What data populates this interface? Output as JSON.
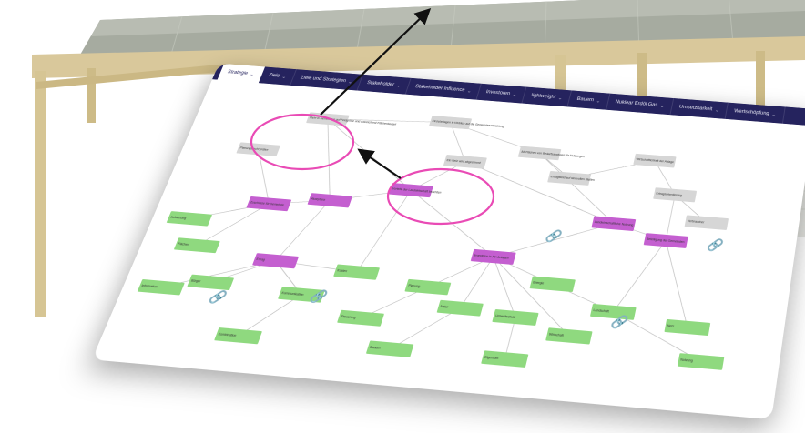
{
  "tabs": [
    {
      "label": "Strategie",
      "active": true
    },
    {
      "label": "Ziele"
    },
    {
      "label": "Ziele und Strategien"
    },
    {
      "label": "Stakeholder"
    },
    {
      "label": "Stakeholder Influence"
    },
    {
      "label": "Investoren"
    },
    {
      "label": "lightweight"
    },
    {
      "label": "Bauern"
    },
    {
      "label": "Nuklear Erdöl Gas"
    },
    {
      "label": "Umsetzbarkeit"
    },
    {
      "label": "Wertschöpfung"
    }
  ],
  "colors": {
    "tab_bar": "#25235e",
    "gray_node": "#d6d6d6",
    "purple_node": "#c45fd0",
    "green_node": "#8fd97f",
    "highlight_ring": "#e94bb5",
    "arrow": "#111111",
    "roof_wood": "#d9c89b",
    "roof_panels": "#a6aba0"
  },
  "icons": {
    "link": "link-icon",
    "arrow_up": "arrow-up-icon"
  },
  "nodes": [
    {
      "id": "g1",
      "type": "gray",
      "text": "Mehr in Gemeinden auf Feldgröße und ausreichend Flächenbedarf"
    },
    {
      "id": "g2",
      "type": "gray",
      "text": "Einzelanlagen in Hinblick auf die Gemeindeentwicklung"
    },
    {
      "id": "g3",
      "type": "gray",
      "text": "Ab Flächen von Bedarfsanalysen für Nutzungen"
    },
    {
      "id": "g4",
      "type": "gray",
      "text": "Ertragsfeld auf sinnvollen Stellen"
    },
    {
      "id": "g5",
      "type": "gray",
      "text": "Wirtschaftlichkeit der Anlage"
    },
    {
      "id": "g6",
      "type": "gray",
      "text": "Ertragsorientierung"
    },
    {
      "id": "g7",
      "type": "gray",
      "text": "Planungsrecht prüfen"
    },
    {
      "id": "g8",
      "type": "gray",
      "text": "Verbraucher"
    },
    {
      "id": "g9",
      "type": "gray",
      "text": "Ein Netz wird abgestimmt"
    },
    {
      "id": "p1",
      "type": "purple",
      "text": "Vorteile der Landwirtschaft beachten"
    },
    {
      "id": "p2",
      "type": "purple",
      "text": "Akzeptanz"
    },
    {
      "id": "p3",
      "type": "purple",
      "text": "Zuschüsse für Gemeinde"
    },
    {
      "id": "p4",
      "type": "purple",
      "text": "Landwirtschaftliche Nutzung"
    },
    {
      "id": "p5",
      "type": "purple",
      "text": "Investition in PV-Anlagen"
    },
    {
      "id": "p6",
      "type": "purple",
      "text": "Beteiligung der Gemeinden"
    },
    {
      "id": "p7",
      "type": "purple",
      "text": "Ertrag"
    },
    {
      "id": "n1",
      "type": "green",
      "text": "Aufwertung"
    },
    {
      "id": "n2",
      "type": "green",
      "text": "Flächen"
    },
    {
      "id": "n3",
      "type": "green",
      "text": "Information"
    },
    {
      "id": "n4",
      "type": "green",
      "text": "Bürger"
    },
    {
      "id": "n5",
      "type": "green",
      "text": "Kommunikation"
    },
    {
      "id": "n6",
      "type": "green",
      "text": "Kosten"
    },
    {
      "id": "n7",
      "type": "green",
      "text": "Steuerung"
    },
    {
      "id": "n8",
      "type": "green",
      "text": "Planung"
    },
    {
      "id": "n9",
      "type": "green",
      "text": "Natur"
    },
    {
      "id": "n10",
      "type": "green",
      "text": "Umweltschutz"
    },
    {
      "id": "n11",
      "type": "green",
      "text": "Energie"
    },
    {
      "id": "n12",
      "type": "green",
      "text": "Wirtschaft"
    },
    {
      "id": "n13",
      "type": "green",
      "text": "Landschaft"
    },
    {
      "id": "n14",
      "type": "green",
      "text": "Netz"
    },
    {
      "id": "n15",
      "type": "green",
      "text": "Nutzung"
    },
    {
      "id": "n16",
      "type": "green",
      "text": "Eigentum"
    },
    {
      "id": "n17",
      "type": "green",
      "text": "Bauern"
    },
    {
      "id": "n18",
      "type": "green",
      "text": "Kombination"
    }
  ]
}
